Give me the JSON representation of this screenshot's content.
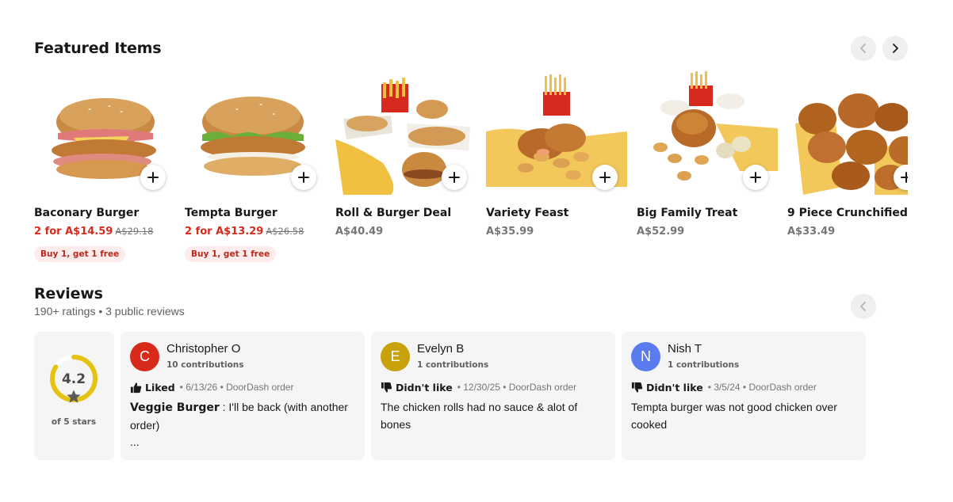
{
  "featured": {
    "title": "Featured Items",
    "items": [
      {
        "name": "Baconary Burger",
        "price": "2 for A$14.59",
        "old_price": "A$29.18",
        "badge": "Buy 1, get 1 free",
        "promo": true,
        "image": "bacon-chicken-burger"
      },
      {
        "name": "Tempta Burger",
        "price": "2 for A$13.29",
        "old_price": "A$26.58",
        "badge": "Buy 1, get 1 free",
        "promo": true,
        "image": "chicken-lettuce-burger"
      },
      {
        "name": "Roll & Burger Deal",
        "price": "A$40.49",
        "image": "rolls-burgers-chips"
      },
      {
        "name": "Variety Feast",
        "price": "A$35.99",
        "image": "nuggets-chicken-chips"
      },
      {
        "name": "Big Family Treat",
        "price": "A$52.99",
        "image": "roast-chicken-nuggets"
      },
      {
        "name": "9 Piece Crunchified",
        "price": "A$33.49",
        "image": "fried-chicken-pieces"
      }
    ]
  },
  "reviews": {
    "title": "Reviews",
    "subtitle": "190+ ratings • 3 public reviews",
    "rating": "4.2",
    "rating_value": 4.2,
    "rating_max": 5,
    "rating_caption": "of 5 stars",
    "items": [
      {
        "initial": "C",
        "name": "Christopher O",
        "contributions": "10 contributions",
        "verdict": "Liked",
        "verdict_icon": "thumbs-up-icon",
        "meta": "• 6/13/26 • DoorDash order",
        "dish": "Veggie Burger",
        "text": " : I'll be back (with another order)",
        "more": "...",
        "color": "#d82a1b"
      },
      {
        "initial": "E",
        "name": "Evelyn B",
        "contributions": "1 contributions",
        "verdict": "Didn't like",
        "verdict_icon": "thumbs-down-icon",
        "meta": "• 12/30/25 • DoorDash order",
        "text": "The chicken rolls had no sauce & alot of bones",
        "color": "#c9a10a"
      },
      {
        "initial": "N",
        "name": "Nish T",
        "contributions": "1 contributions",
        "verdict": "Didn't like",
        "verdict_icon": "thumbs-down-icon",
        "meta": "• 3/5/24 • DoorDash order",
        "text": "Tempta burger was not good chicken over cooked",
        "color": "#5a7cf0"
      }
    ]
  },
  "colors": {
    "promo": "#d42b1e",
    "badge_bg": "#fdeceb",
    "rating_ring": "#e6c212"
  }
}
